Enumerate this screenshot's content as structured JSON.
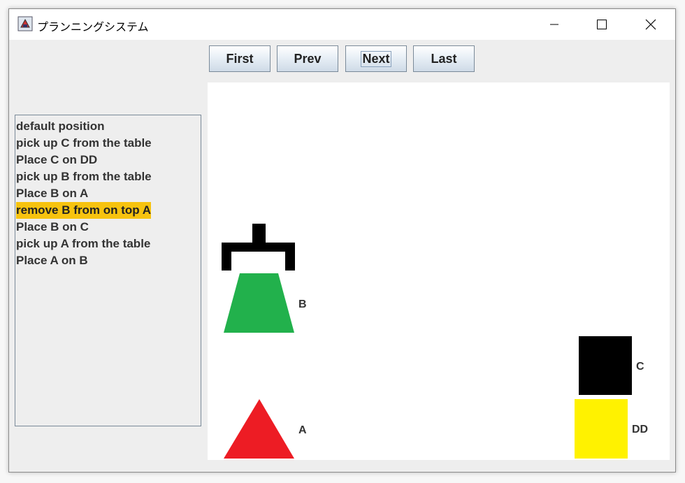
{
  "window": {
    "title": "プランニングシステム",
    "controls": [
      "minimize",
      "maximize",
      "close"
    ]
  },
  "toolbar": {
    "first_label": "First",
    "prev_label": "Prev",
    "next_label": "Next",
    "last_label": "Last"
  },
  "steps": {
    "selected_index": 5,
    "items": [
      "default position",
      "pick up C from the table",
      "Place C on DD",
      "pick up B from the table",
      "Place B on A",
      "remove B from on top A",
      "Place B on C",
      "pick up A from the table",
      "Place A on B"
    ]
  },
  "scene": {
    "blocks": {
      "B": {
        "label": "B",
        "shape": "trapezoid",
        "color": "#22b14c"
      },
      "A": {
        "label": "A",
        "shape": "triangle",
        "color": "#ed1c24"
      },
      "C": {
        "label": "C",
        "shape": "square",
        "color": "#000000"
      },
      "DD": {
        "label": "DD",
        "shape": "square",
        "color": "#fff200"
      }
    },
    "gripper": {
      "color": "#000000",
      "holding": "B"
    }
  },
  "colors": {
    "selection": "#f7c30f",
    "window_bg": "#eeeeee",
    "canvas_bg": "#ffffff"
  }
}
